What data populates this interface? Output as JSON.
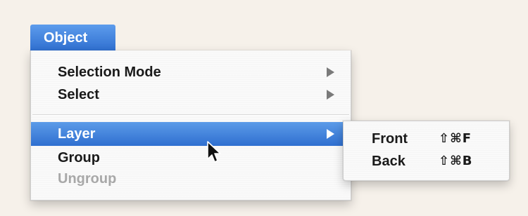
{
  "menu_title": "Object",
  "menu": {
    "items": [
      {
        "label": "Selection Mode",
        "has_submenu": true,
        "state": "normal"
      },
      {
        "label": "Select",
        "has_submenu": true,
        "state": "normal"
      },
      {
        "label": "Layer",
        "has_submenu": true,
        "state": "selected"
      },
      {
        "label": "Group",
        "has_submenu": false,
        "state": "normal"
      },
      {
        "label": "Ungroup",
        "has_submenu": false,
        "state": "disabled"
      }
    ]
  },
  "submenu": {
    "items": [
      {
        "label": "Front",
        "shortcut": "⇧⌘F"
      },
      {
        "label": "Back",
        "shortcut": "⇧⌘B"
      }
    ]
  },
  "colors": {
    "highlight": "#3d7fdc",
    "background": "#f6f1ea",
    "disabled_text": "#a8a8a8"
  },
  "icons": {
    "submenu_indicator": "triangle-right-icon",
    "pointer": "mouse-pointer-icon"
  }
}
